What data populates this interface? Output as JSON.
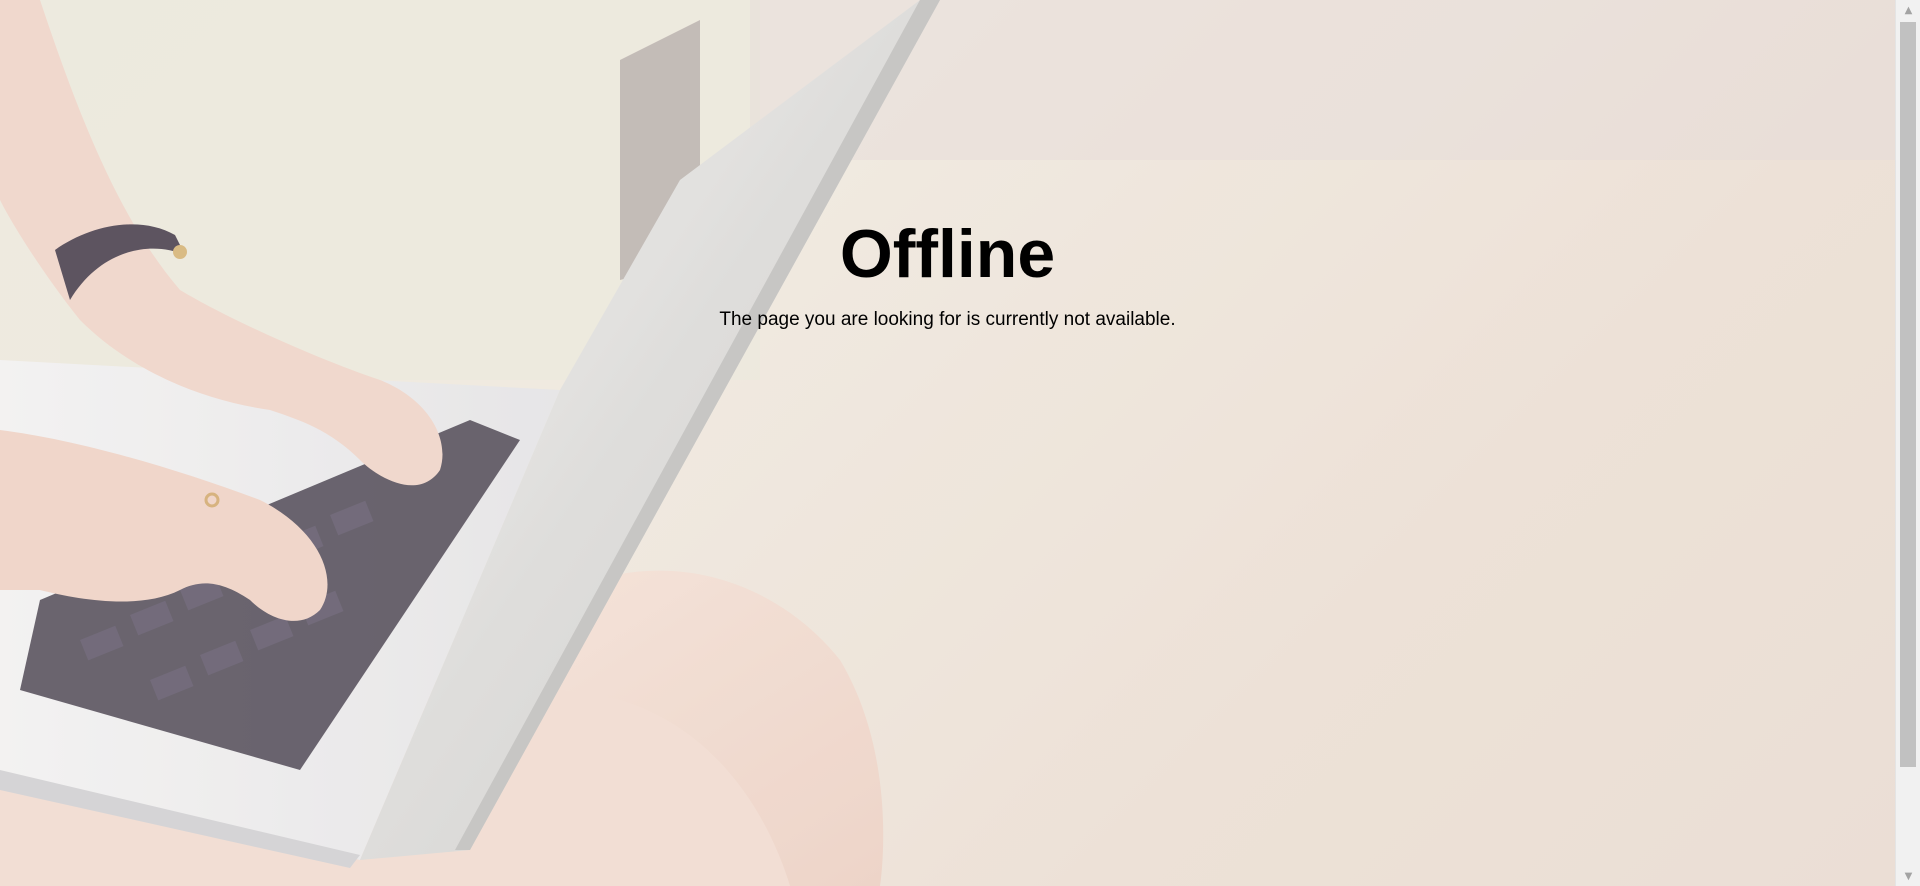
{
  "page": {
    "title": "Offline",
    "message": "The page you are looking for is currently not available."
  },
  "scrollbar": {
    "up_icon": "triangle-up-icon",
    "down_icon": "triangle-down-icon",
    "up_glyph": "▲",
    "down_glyph": "▼"
  },
  "colors": {
    "text": "#000000",
    "background": "#ece6de",
    "scrollbar_track": "#f1f1f1",
    "scrollbar_thumb": "#c1c1c1"
  }
}
